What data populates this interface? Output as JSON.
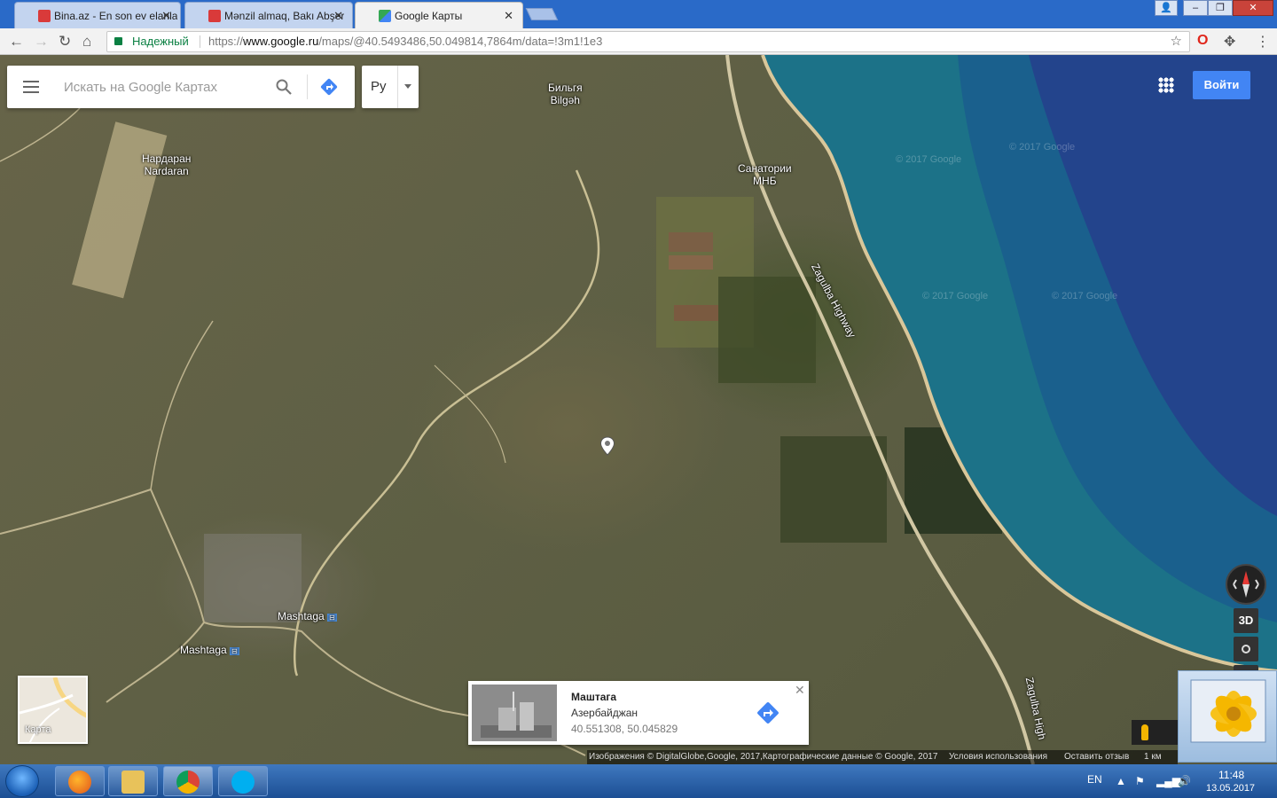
{
  "browser": {
    "tabs": [
      {
        "label": "Bina.az - En son ev elanla",
        "favicon_color": "#d93a3a"
      },
      {
        "label": "Mənzil almaq, Bakı Abşer",
        "favicon_color": "#d93a3a"
      },
      {
        "label": "Google Карты",
        "favicon_color": "#34a853"
      }
    ],
    "secure_label": "Надежный",
    "url_prefix": "https://",
    "url_host": "www.google.ru",
    "url_path": "/maps/@40.5493486,50.049814,7864m/data=!3m1!1e3"
  },
  "maps": {
    "search_placeholder": "Искать на Google Картах",
    "language_value": "Ру",
    "signin_label": "Войти",
    "labels": {
      "bilgah_ru": "Бильгя",
      "bilgah_az": "Bilgəh",
      "nardaran_ru": "Нардаран",
      "nardaran_az": "Nardaran",
      "sanatorium_1": "Санатории",
      "sanatorium_2": "МНБ",
      "highway_1": "Zagulba Highway",
      "highway_2": "Zagulba High",
      "mashtaga_1": "Mashtaga",
      "mashtaga_2": "Mashtaga"
    },
    "watermark": "© 2017 Google",
    "btn_3d": "3D",
    "maptype_label": "Карта",
    "info_card": {
      "name": "Маштага",
      "country": "Азербайджан",
      "coords": "40.551308, 50.045829"
    },
    "attribution": {
      "imagery": "Изображения © DigitalGlobe,Google, 2017,Картографические данные © Google, 2017",
      "terms": "Условия использования",
      "feedback": "Оставить отзыв",
      "scale": "1 км"
    }
  },
  "taskbar": {
    "lang": "EN",
    "time": "11:48",
    "date": "13.05.2017"
  },
  "colors": {
    "accent": "#4285f4",
    "sea": "#1f6f86",
    "deep_sea": "#2a3f8f",
    "secure": "#0b8043"
  }
}
